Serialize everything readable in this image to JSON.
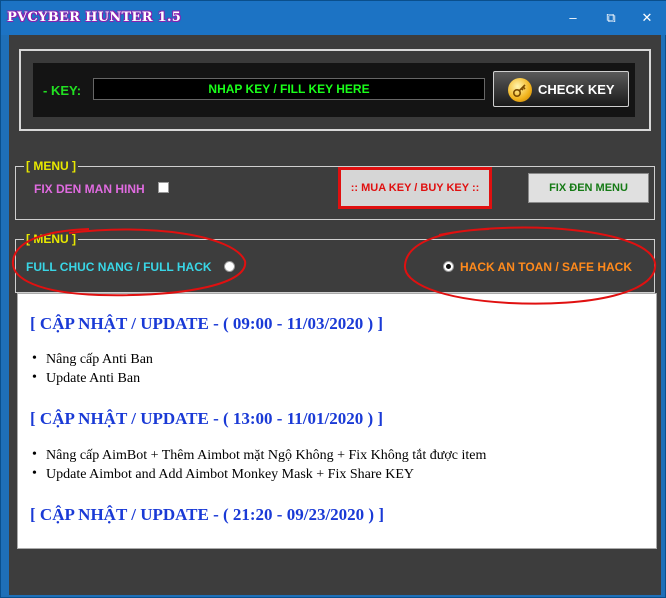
{
  "window": {
    "title": "PVCYBER HUNTER 1.5",
    "minimize_glyph": "–",
    "maximize_glyph": "⧉",
    "close_glyph": "✕"
  },
  "key_panel": {
    "label": "- KEY:",
    "input_value": "NHAP KEY  / FILL KEY HERE",
    "check_button_label": "CHECK KEY",
    "check_icon": "key-icon"
  },
  "menu1": {
    "legend": "[ MENU ]",
    "fix_den_label": "FIX DEN MAN HINH",
    "fix_den_checked": false,
    "buy_key_label": ":: MUA KEY / BUY KEY ::",
    "fix_menu_label": "FIX ĐEN MENU"
  },
  "menu2": {
    "legend": "[ MENU ]",
    "full_hack_label": "FULL CHUC NANG / FULL HACK",
    "full_hack_selected": false,
    "safe_hack_label": "HACK AN TOAN / SAFE HACK",
    "safe_hack_selected": true
  },
  "updates": [
    {
      "heading": "[ CẬP NHẬT / UPDATE - ( 09:00 - 11/03/2020 ) ]",
      "items": [
        "Nâng cấp Anti Ban",
        "Update Anti Ban"
      ]
    },
    {
      "heading": "[ CẬP NHẬT / UPDATE - ( 13:00 - 11/01/2020 ) ]",
      "items": [
        "Nâng cấp AimBot + Thêm Aimbot mặt Ngộ Không + Fix Không tắt được item",
        "Update Aimbot and Add Aimbot Monkey Mask + Fix Share KEY"
      ]
    },
    {
      "heading": "[ CẬP NHẬT / UPDATE - ( 21:20 - 09/23/2020 ) ]",
      "items": []
    }
  ],
  "colors": {
    "key_label": "#22e022",
    "buy_key": "#e01010",
    "fix_den": "#e06be0",
    "full_hack": "#39d6e6",
    "safe_hack": "#ff8a1c",
    "legend": "#e8e800",
    "update_heading": "#1a3ad6",
    "annotation": "#e01010"
  }
}
